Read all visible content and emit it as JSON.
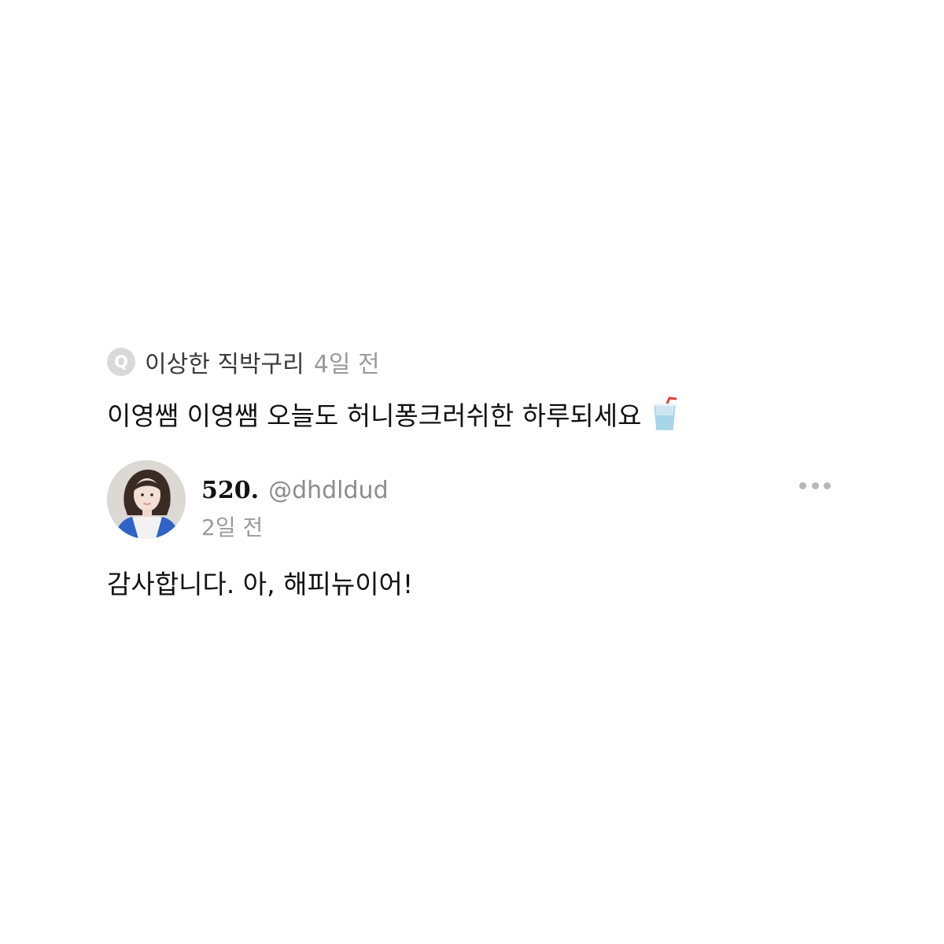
{
  "question": {
    "badge_label": "Q",
    "asker_name": "이상한 직박구리",
    "asked_time": "4일 전",
    "text": "이영쌤 이영쌤 오늘도 허니퐁크러쉬한 하루되세요",
    "emoji_icon": "cup-with-straw-icon"
  },
  "answer": {
    "author_name": "520.",
    "author_handle": "@dhdldud",
    "time": "2일 전",
    "text": "감사합니다. 아, 해피뉴이어!",
    "avatar_icon": "profile-photo",
    "more_icon": "more-horizontal-icon"
  },
  "colors": {
    "badge_bg": "#d9d9d9",
    "secondary_text": "#9a9a9a",
    "primary_text": "#111111",
    "more_dots": "#b8b8b8"
  }
}
